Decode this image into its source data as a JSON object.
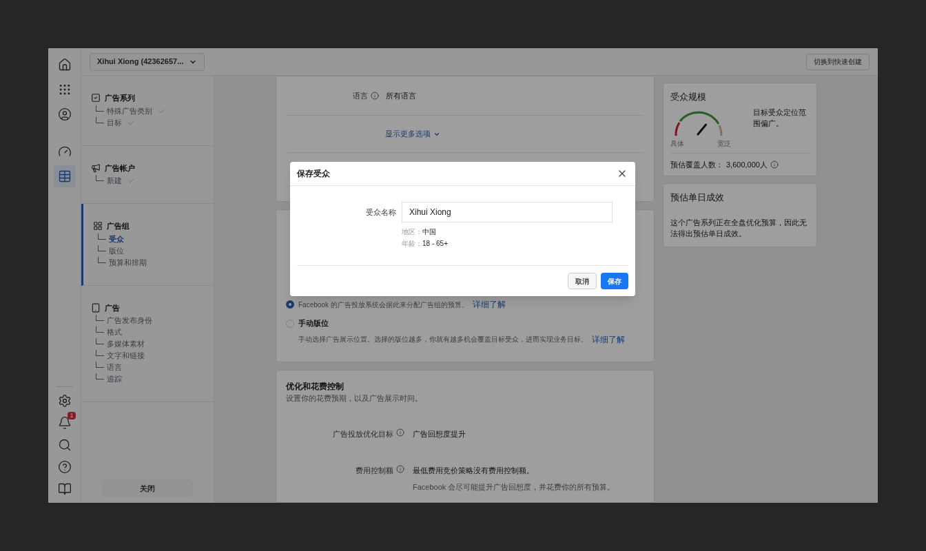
{
  "account_selector": {
    "label": "Xihui Xiong (42362657..."
  },
  "top_bar": {
    "button": "切换到快速创建"
  },
  "rail": {
    "top": [
      {
        "selected": false
      },
      {
        "selected": false
      },
      {
        "selected": false
      },
      {
        "selected": false
      },
      {
        "selected": true
      }
    ],
    "bottom": [
      {
        "selected": false
      },
      {
        "selected": false,
        "badge": "1"
      },
      {
        "selected": false
      },
      {
        "selected": false
      },
      {
        "selected": false
      }
    ]
  },
  "sidebar": {
    "sections": [
      {
        "title": "广告系列",
        "selected": false,
        "items": [
          {
            "label": "特殊广告类别",
            "done": true,
            "selected": false
          },
          {
            "label": "目标",
            "done": true,
            "selected": false
          }
        ]
      },
      {
        "title": "广告帐户",
        "selected": false,
        "items": [
          {
            "label": "新建",
            "done": true,
            "selected": false
          }
        ]
      },
      {
        "title": "广告组",
        "selected": true,
        "items": [
          {
            "label": "受众",
            "done": false,
            "selected": true
          },
          {
            "label": "版位",
            "done": false,
            "selected": false
          },
          {
            "label": "预算和排期",
            "done": false,
            "selected": false
          }
        ]
      },
      {
        "title": "广告",
        "selected": false,
        "items": [
          {
            "label": "广告发布身份",
            "done": false,
            "selected": false
          },
          {
            "label": "格式",
            "done": false,
            "selected": false
          },
          {
            "label": "多媒体素材",
            "done": false,
            "selected": false
          },
          {
            "label": "文字和链接",
            "done": false,
            "selected": false
          },
          {
            "label": "语言",
            "done": false,
            "selected": false
          },
          {
            "label": "追踪",
            "done": false,
            "selected": false
          }
        ]
      }
    ],
    "close_button": "关闭"
  },
  "audience_card": {
    "language_label": "语言",
    "language_value": "所有语言",
    "more_options": "显示更多选项"
  },
  "placements_card": {
    "options": [
      {
        "selected": true,
        "description": "Facebook 的广告投放系统会据此来分配广告组的预算。",
        "link": "详细了解"
      },
      {
        "selected": false,
        "title": "手动版位",
        "description": "手动选择广告展示位置。选择的版位越多，你就有越多机会覆盖目标受众，进而实现业务目标。",
        "link": "详细了解"
      }
    ]
  },
  "optimization_card": {
    "title": "优化和花费控制",
    "subtitle": "设置你的花费预期，以及广告展示时间。",
    "rows": [
      {
        "label": "广告投放优化目标",
        "value": "广告回想度提升"
      },
      {
        "label": "费用控制额",
        "value": "最低费用竞价策略没有费用控制额。",
        "note": "Facebook 会尽可能提升广告回想度，并花费你的所有预算。"
      }
    ]
  },
  "audience_size": {
    "title": "受众规模",
    "low_label": "具体",
    "high_label": "宽泛",
    "description": "目标受众定位范围偏广。",
    "estimate_label": "预估覆盖人数：",
    "estimate": "3,600,000人"
  },
  "daily_results": {
    "title": "预估单日成效",
    "text": "这个广告系列正在全盘优化预算，因此无法得出预估单日成效。"
  },
  "dialog": {
    "title": "保存受众",
    "field_label": "受众名称",
    "field_value": "Xihui Xiong",
    "details": [
      {
        "label": "地区：",
        "value": "中国"
      },
      {
        "label": "年龄：",
        "value": "18 - 65+"
      }
    ],
    "buttons": [
      {
        "kind": "secondary",
        "label": "取消"
      },
      {
        "kind": "primary",
        "label": "保存"
      }
    ]
  }
}
